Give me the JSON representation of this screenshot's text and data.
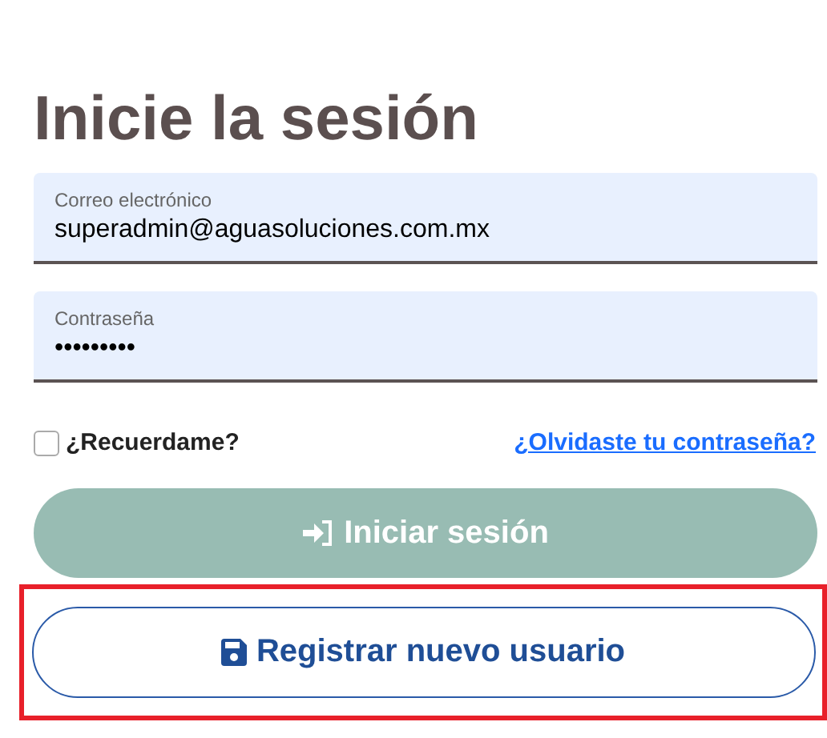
{
  "title": "Inicie la sesión",
  "fields": [
    {
      "label": "Correo electrónico",
      "value": "superadmin@aguasoluciones.com.mx"
    },
    {
      "label": "Contraseña",
      "value": "•••••••••"
    }
  ],
  "remember": {
    "label": "¿Recuerdame?",
    "checked": false
  },
  "forgot_link": "¿Olvidaste tu contraseña?",
  "login_button": {
    "label": "Iniciar sesión",
    "disabled": true
  },
  "register_button": {
    "label": "Registrar nuevo usuario",
    "highlighted": true
  }
}
